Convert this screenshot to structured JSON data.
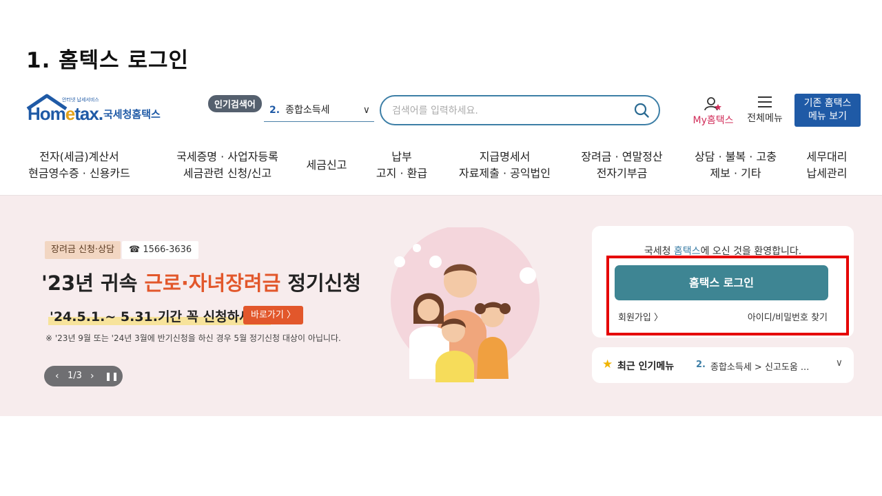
{
  "slide": {
    "title": "1. 홈텍스 로그인"
  },
  "header": {
    "logo_word_pre": "Hom",
    "logo_word_e": "e",
    "logo_word_post": "tax.",
    "logo_tagline": "안터넷 납세서비스",
    "logo_name": "국세청홈택스",
    "popular_badge": "인기검색어",
    "popular_rank": "2.",
    "popular_term": "종합소득세",
    "search_placeholder": "검색어를 입력하세요.",
    "my_label": "My홈택스",
    "allmenu_label": "전체메뉴",
    "oldmenu_line1": "기존 홈택스",
    "oldmenu_line2": "메뉴 보기"
  },
  "nav": [
    {
      "line1": "전자(세금)계산서",
      "line2": "현금영수증 · 신용카드"
    },
    {
      "line1": "국세증명 · 사업자등록",
      "line2": "세금관련 신청/신고"
    },
    {
      "line1": "세금신고",
      "line2": ""
    },
    {
      "line1": "납부",
      "line2": "고지 · 환급"
    },
    {
      "line1": "지급명세서",
      "line2": "자료제출 · 공익법인"
    },
    {
      "line1": "장려금 · 연말정산",
      "line2": "전자기부금"
    },
    {
      "line1": "상담 · 불복 · 고충",
      "line2": "제보 · 기타"
    },
    {
      "line1": "세무대리",
      "line2": "납세관리"
    }
  ],
  "banner": {
    "tag": "장려금 신청·상담",
    "phone": "☎ 1566-3636",
    "headline_pre": "'23년 귀속 ",
    "headline_hl": "근로·자녀장려금",
    "headline_post": " 정기신청",
    "period": "'24.5.1.~ 5.31.기간 꼭 신청하세요!",
    "go_button": "바로가기 〉",
    "note": "※ '23년 9월 또는 '24년 3월에 반기신청을 하신 경우 5월 정기신청 대상이 아닙니다.",
    "pager_text": "1/3"
  },
  "login": {
    "welcome_pre": "국세청 ",
    "welcome_brand": "홈택스",
    "welcome_post": "에 오신 것을 환영합니다.",
    "login_button": "홈택스 로그인",
    "signup": "회원가입 〉",
    "find": "아이디/비밀번호 찾기"
  },
  "recent": {
    "label": "최근 인기메뉴",
    "rank": "2.",
    "text": "종합소득세 > 신고도움 ..."
  },
  "colors": {
    "brand_blue": "#1f5aa6",
    "login_teal": "#3e8593",
    "accent_orange": "#e2572b",
    "hero_bg": "#f7eced",
    "highlight_red": "#e50000"
  }
}
